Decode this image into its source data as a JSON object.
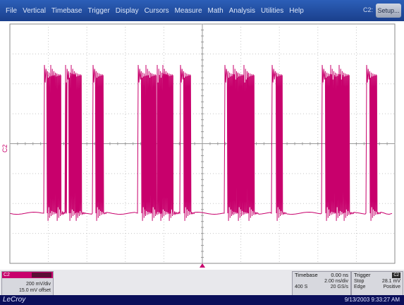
{
  "menu": {
    "items": [
      "File",
      "Vertical",
      "Timebase",
      "Trigger",
      "Display",
      "Cursors",
      "Measure",
      "Math",
      "Analysis",
      "Utilities",
      "Help"
    ],
    "channel_indicator": "C2:",
    "setup_label": "Setup..."
  },
  "trace": {
    "label": "C2",
    "color": "#c8006c"
  },
  "channel_panel": {
    "name": "C2",
    "volts_per_div": "200 mV/div",
    "offset": "15.0 mV offset"
  },
  "timebase": {
    "title": "Timebase",
    "delay": "0.00 ns",
    "time_per_div": "2.00 ns/div",
    "samples": "400 S",
    "sample_rate": "20 GS/s"
  },
  "trigger": {
    "title": "Trigger",
    "mode_label": "C2",
    "mode": "Stop",
    "level": "28.1 mV",
    "type": "Edge",
    "slope": "Positive"
  },
  "status": {
    "brand": "LeCroy",
    "timestamp": "9/13/2003 9:33:27 AM"
  }
}
